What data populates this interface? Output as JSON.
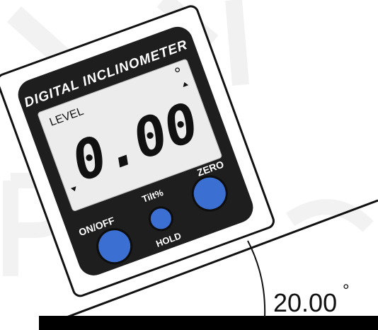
{
  "device": {
    "title": "DIGITAL INCLINOMETER",
    "mode_label": "LEVEL",
    "reading": "0.00",
    "degree_symbol": "°",
    "buttons": {
      "on_off_label": "ON/OFF",
      "tilt_label": "Tilt%",
      "hold_label": "HOLD",
      "zero_label": "ZERO"
    }
  },
  "incline": {
    "angle_label": "20.00",
    "angle_unit": "°"
  },
  "colors": {
    "button_blue": "#3b6fd1",
    "bezel": "#1e1e1e",
    "lcd": "#ececec",
    "housing": "#ffffff"
  }
}
